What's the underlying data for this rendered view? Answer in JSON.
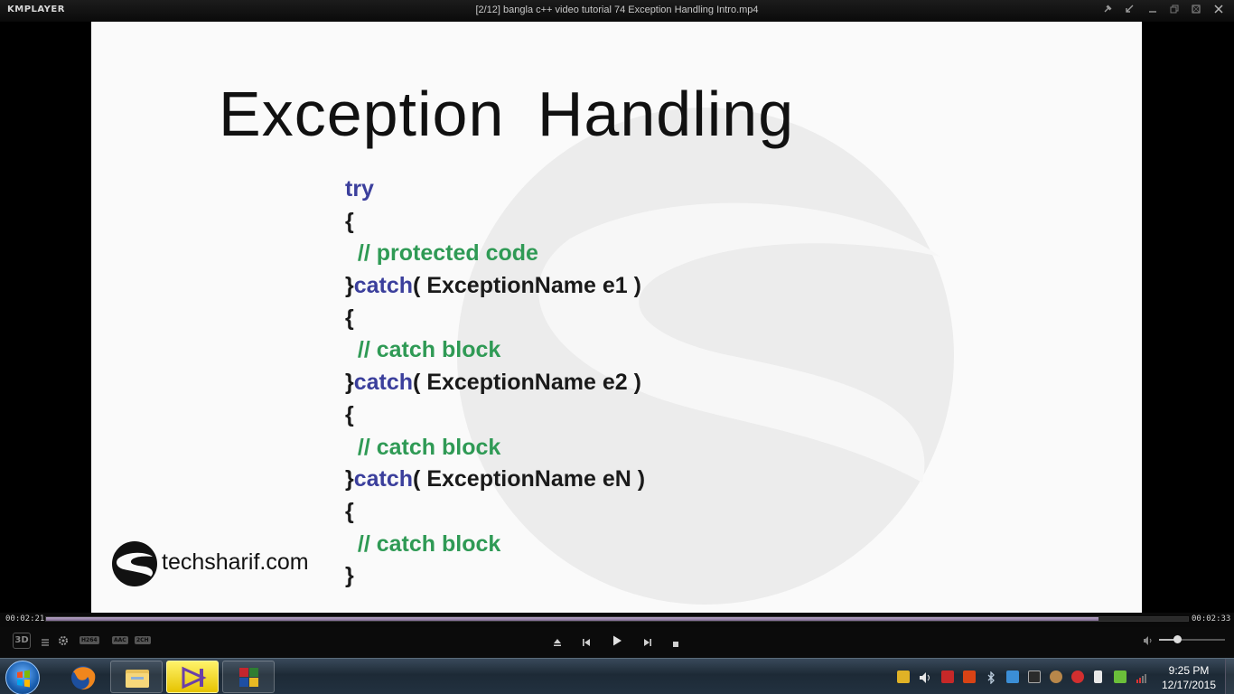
{
  "app": {
    "logo": "KMPLAYER",
    "window_title": "[2/12] bangla c++ video tutorial 74 Exception Handling Intro.mp4"
  },
  "slide": {
    "title": "Exception  Handling",
    "code": [
      {
        "segments": [
          {
            "text": "try",
            "style": "kw"
          }
        ]
      },
      {
        "segments": [
          {
            "text": "{",
            "style": "plain"
          }
        ]
      },
      {
        "segments": [
          {
            "text": "  // protected code",
            "style": "cm"
          }
        ]
      },
      {
        "segments": [
          {
            "text": "}",
            "style": "plain"
          },
          {
            "text": "catch",
            "style": "kw"
          },
          {
            "text": "( ExceptionName e1 )",
            "style": "plain"
          }
        ]
      },
      {
        "segments": [
          {
            "text": "{",
            "style": "plain"
          }
        ]
      },
      {
        "segments": [
          {
            "text": "  // catch block",
            "style": "cm"
          }
        ]
      },
      {
        "segments": [
          {
            "text": "}",
            "style": "plain"
          },
          {
            "text": "catch",
            "style": "kw"
          },
          {
            "text": "( ExceptionName e2 )",
            "style": "plain"
          }
        ]
      },
      {
        "segments": [
          {
            "text": "{",
            "style": "plain"
          }
        ]
      },
      {
        "segments": [
          {
            "text": "  // catch block",
            "style": "cm"
          }
        ]
      },
      {
        "segments": [
          {
            "text": "}",
            "style": "plain"
          },
          {
            "text": "catch",
            "style": "kw"
          },
          {
            "text": "( ExceptionName eN )",
            "style": "plain"
          }
        ]
      },
      {
        "segments": [
          {
            "text": "{",
            "style": "plain"
          }
        ]
      },
      {
        "segments": [
          {
            "text": "  // catch block",
            "style": "cm"
          }
        ]
      },
      {
        "segments": [
          {
            "text": "}",
            "style": "plain"
          }
        ]
      }
    ],
    "brand": "techsharif.com"
  },
  "playback": {
    "elapsed": "00:02:21",
    "total": "00:02:33",
    "progress": 0.922
  },
  "controls": {
    "badges": [
      "H264",
      "AAC",
      "2CH"
    ],
    "icons": [
      "3d-icon",
      "playlist-icon",
      "settings-icon",
      "eject-icon",
      "previous-icon",
      "play-icon",
      "next-icon",
      "stop-icon",
      "volume-icon"
    ],
    "volume_level": 0.27
  },
  "taskbar": {
    "apps": [
      "firefox",
      "windows-explorer",
      "visual-studio",
      "winrar"
    ],
    "tray": [
      "power-icon",
      "speaker-icon",
      "mcafee-icon",
      "tool-icon",
      "bluetooth-icon",
      "network-icon",
      "camera-icon",
      "opera-icon",
      "battery-icon",
      "check-icon",
      "signal-icon"
    ],
    "time": "9:25 PM",
    "date": "12/17/2015"
  },
  "colors": {
    "keyword": "#3b3f9c",
    "comment": "#2f9a55",
    "progress": "#a593b8"
  }
}
